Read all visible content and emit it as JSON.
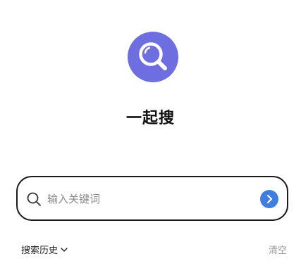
{
  "app": {
    "title": "一起搜",
    "logo_icon": "magnifier-icon",
    "logo_color": "#6e6ee0"
  },
  "search": {
    "placeholder": "输入关键词",
    "value": "",
    "search_icon": "search-icon",
    "go_icon": "arrow-right-circle-icon",
    "go_color": "#3f7de0"
  },
  "history": {
    "label": "搜索历史",
    "chevron_icon": "chevron-down-icon",
    "clear_label": "清空"
  }
}
